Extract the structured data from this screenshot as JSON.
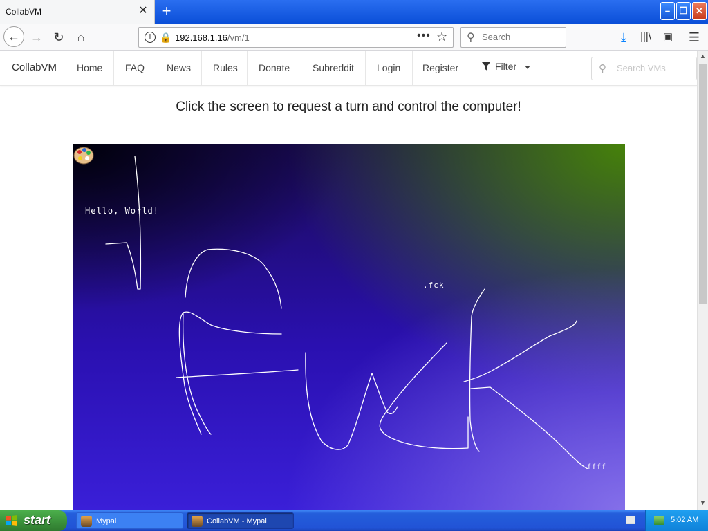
{
  "browser": {
    "tab_title": "CollabVM",
    "tab_close": "✕",
    "new_tab": "+",
    "window_controls": {
      "minimize": "–",
      "maximize": "❐",
      "close": "✕"
    },
    "url_host": "192.168.1.16",
    "url_path": "/vm/1",
    "search_placeholder": "Search",
    "icons": [
      "back-arrow",
      "forward-arrow",
      "reload",
      "home",
      "info",
      "insecure-lock",
      "page-actions",
      "bookmark-star",
      "search",
      "download-arrow",
      "library",
      "sidebar",
      "hamburger-menu"
    ]
  },
  "site_nav": {
    "brand": "CollabVM",
    "links": [
      "Home",
      "FAQ",
      "News",
      "Rules",
      "Donate",
      "Subreddit",
      "Login",
      "Register"
    ],
    "filter_label": "Filter",
    "search_placeholder": "Search VMs"
  },
  "main": {
    "turn_message": "Click the screen to request a turn and control the computer!"
  },
  "vm_screen": {
    "hello_text": "Hello, World!",
    "fck_text": ".fck",
    "ffff_text": "ffff"
  },
  "taskbar": {
    "start_label": "start",
    "tasks": [
      "Mypal",
      "CollabVM - Mypal"
    ],
    "clock": "5:02 AM"
  },
  "colors": {
    "title_bar": "#0b4fd8",
    "taskbar": "#245edb",
    "start_button": "#3a8f3a",
    "download_icon": "#0a84ff",
    "insecure_icon": "#d70022"
  }
}
